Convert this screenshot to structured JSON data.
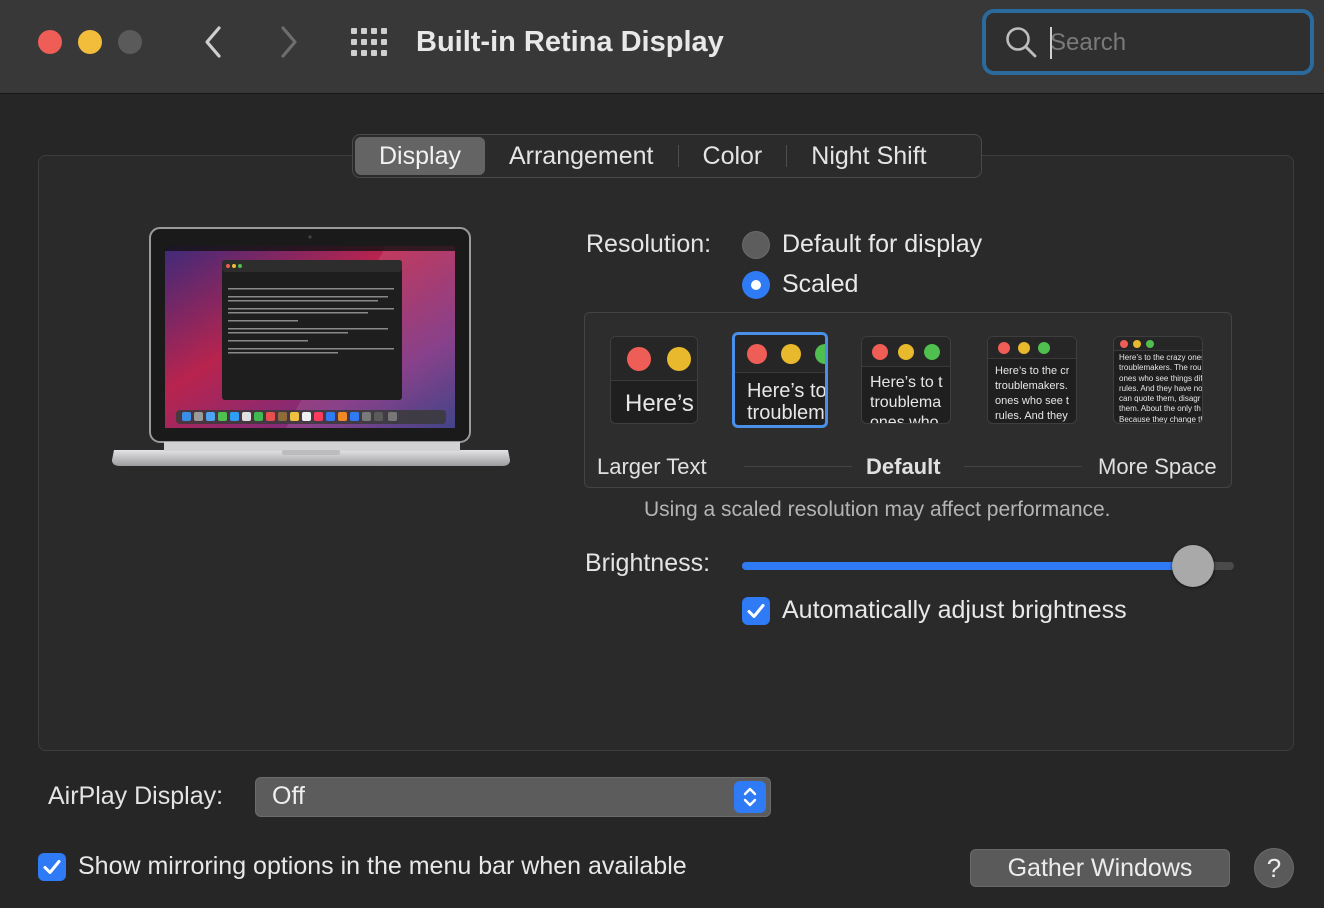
{
  "window": {
    "title": "Built-in Retina Display"
  },
  "search": {
    "placeholder": "Search",
    "value": ""
  },
  "tabs": [
    {
      "label": "Display",
      "selected": true
    },
    {
      "label": "Arrangement",
      "selected": false
    },
    {
      "label": "Color",
      "selected": false
    },
    {
      "label": "Night Shift",
      "selected": false
    }
  ],
  "resolution": {
    "label": "Resolution:",
    "options": [
      {
        "label": "Default for display",
        "selected": false
      },
      {
        "label": "Scaled",
        "selected": true
      }
    ],
    "scale_labels": {
      "left": "Larger Text",
      "middle": "Default",
      "right": "More Space"
    },
    "thumbnails": [
      {
        "text": "Here’s"
      },
      {
        "text": "Here’s to\ntroublem"
      },
      {
        "text": "Here’s to t\ntroublema\nones who"
      },
      {
        "text": "Here’s to the cr\ntroublemakers.\nones who see t\nrules. And they"
      },
      {
        "text": "Here’s to the crazy ones\ntroublemakers. The rou\nones who see things dif\nrules. And they have no\ncan quote them, disagr\nthem. About the only th\nBecause they change th"
      }
    ],
    "selected_thumbnail": 1,
    "note": "Using a scaled resolution may affect performance."
  },
  "brightness": {
    "label": "Brightness:",
    "level": 0.93,
    "auto_label": "Automatically adjust brightness",
    "auto_checked": true
  },
  "airplay": {
    "label": "AirPlay Display:",
    "value": "Off"
  },
  "mirroring": {
    "label": "Show mirroring options in the menu bar when available",
    "checked": true
  },
  "buttons": {
    "gather_windows": "Gather Windows",
    "help": "?"
  },
  "colors": {
    "accent": "#2f7bf5",
    "close": "#ee5e57",
    "minimize": "#f3bd3c",
    "zoom_disabled": "#5a5a5a",
    "search_focus": "#2a6a9d"
  },
  "icons": {
    "back": "chevron-left-icon",
    "forward": "chevron-right-icon",
    "show_all": "grid-icon",
    "search": "search-icon"
  }
}
